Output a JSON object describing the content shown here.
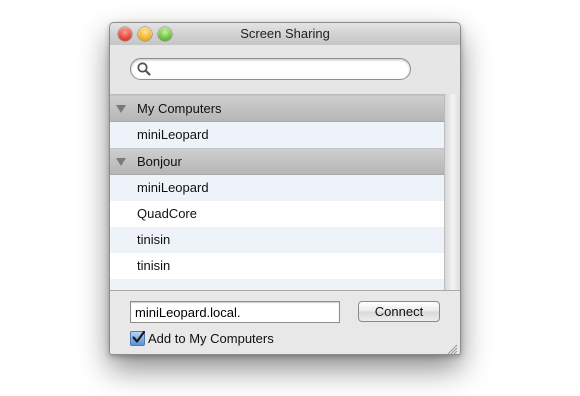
{
  "window": {
    "title": "Screen Sharing"
  },
  "search": {
    "value": "",
    "placeholder": ""
  },
  "list": {
    "groups": [
      {
        "label": "My Computers",
        "items": [
          "miniLeopard"
        ]
      },
      {
        "label": "Bonjour",
        "items": [
          "miniLeopard",
          "QuadCore",
          "tinisin",
          "tinisin"
        ]
      }
    ]
  },
  "bottom": {
    "address_value": "miniLeopard.local.",
    "connect_label": "Connect",
    "add_checkbox_label": "Add to My Computers",
    "add_checkbox_checked": true
  },
  "colors": {
    "group_header": "#c2c2c2",
    "alt_row": "#eef3fa",
    "checkbox_blue": "#5b91d8"
  }
}
